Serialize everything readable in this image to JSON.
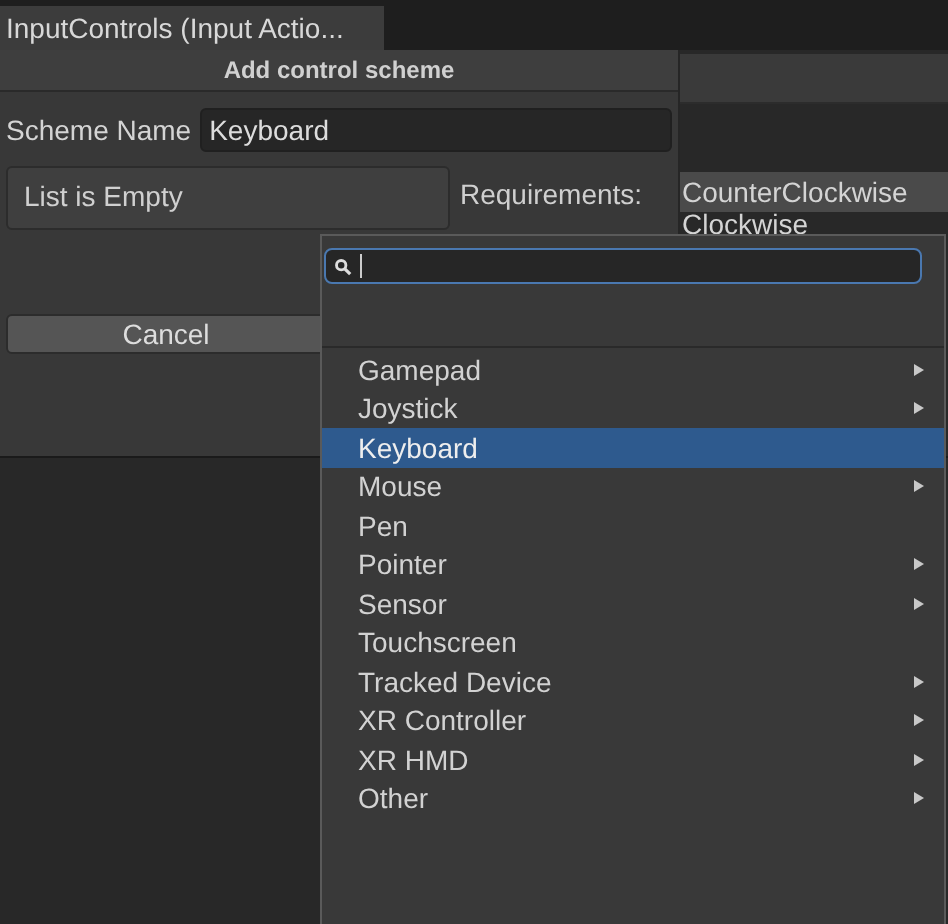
{
  "tab": {
    "title": "InputControls (Input Actio..."
  },
  "dialog": {
    "title": "Add control scheme",
    "scheme_name": {
      "label": "Scheme Name",
      "value": "Keyboard"
    },
    "list": {
      "empty_text": "List is Empty"
    },
    "requirements_label": "Requirements:",
    "buttons": [
      "Cancel"
    ]
  },
  "background_list": [
    "CounterClockwise",
    "Clockwise"
  ],
  "dropdown": {
    "items": [
      {
        "label": "Gamepad",
        "submenu": true,
        "selected": false
      },
      {
        "label": "Joystick",
        "submenu": true,
        "selected": false
      },
      {
        "label": "Keyboard",
        "submenu": false,
        "selected": true
      },
      {
        "label": "Mouse",
        "submenu": true,
        "selected": false
      },
      {
        "label": "Pen",
        "submenu": false,
        "selected": false
      },
      {
        "label": "Pointer",
        "submenu": true,
        "selected": false
      },
      {
        "label": "Sensor",
        "submenu": true,
        "selected": false
      },
      {
        "label": "Touchscreen",
        "submenu": false,
        "selected": false
      },
      {
        "label": "Tracked Device",
        "submenu": true,
        "selected": false
      },
      {
        "label": "XR Controller",
        "submenu": true,
        "selected": false
      },
      {
        "label": "XR HMD",
        "submenu": true,
        "selected": false
      },
      {
        "label": "Other",
        "submenu": true,
        "selected": false
      }
    ]
  }
}
